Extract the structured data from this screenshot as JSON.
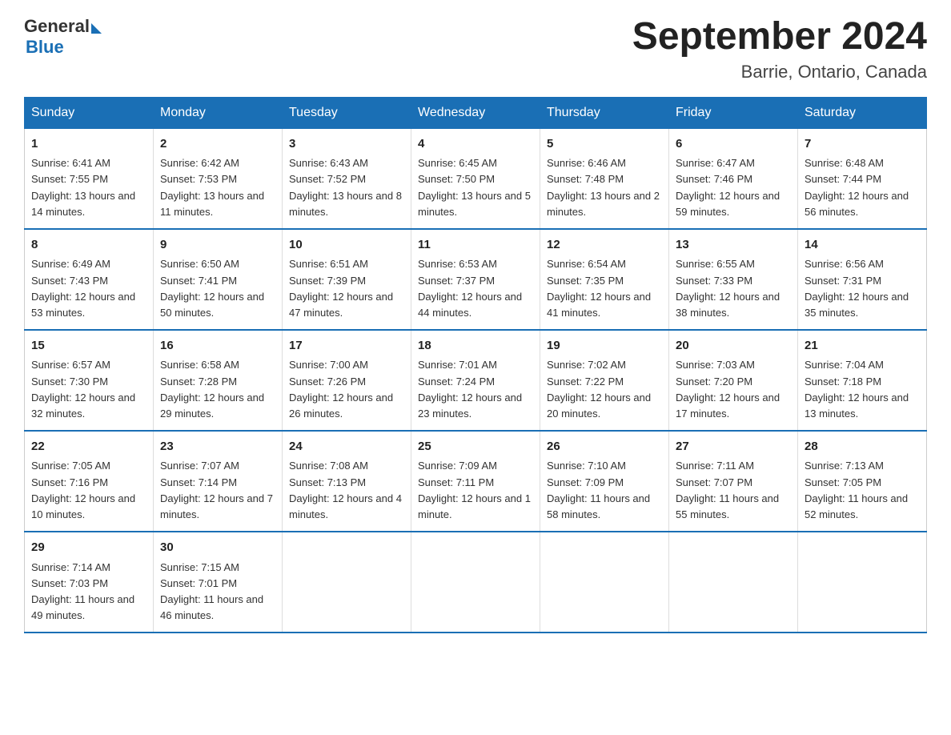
{
  "header": {
    "logo_general": "General",
    "logo_blue": "Blue",
    "month_title": "September 2024",
    "location": "Barrie, Ontario, Canada"
  },
  "days_of_week": [
    "Sunday",
    "Monday",
    "Tuesday",
    "Wednesday",
    "Thursday",
    "Friday",
    "Saturday"
  ],
  "weeks": [
    [
      {
        "day": "1",
        "sunrise": "6:41 AM",
        "sunset": "7:55 PM",
        "daylight": "13 hours and 14 minutes."
      },
      {
        "day": "2",
        "sunrise": "6:42 AM",
        "sunset": "7:53 PM",
        "daylight": "13 hours and 11 minutes."
      },
      {
        "day": "3",
        "sunrise": "6:43 AM",
        "sunset": "7:52 PM",
        "daylight": "13 hours and 8 minutes."
      },
      {
        "day": "4",
        "sunrise": "6:45 AM",
        "sunset": "7:50 PM",
        "daylight": "13 hours and 5 minutes."
      },
      {
        "day": "5",
        "sunrise": "6:46 AM",
        "sunset": "7:48 PM",
        "daylight": "13 hours and 2 minutes."
      },
      {
        "day": "6",
        "sunrise": "6:47 AM",
        "sunset": "7:46 PM",
        "daylight": "12 hours and 59 minutes."
      },
      {
        "day": "7",
        "sunrise": "6:48 AM",
        "sunset": "7:44 PM",
        "daylight": "12 hours and 56 minutes."
      }
    ],
    [
      {
        "day": "8",
        "sunrise": "6:49 AM",
        "sunset": "7:43 PM",
        "daylight": "12 hours and 53 minutes."
      },
      {
        "day": "9",
        "sunrise": "6:50 AM",
        "sunset": "7:41 PM",
        "daylight": "12 hours and 50 minutes."
      },
      {
        "day": "10",
        "sunrise": "6:51 AM",
        "sunset": "7:39 PM",
        "daylight": "12 hours and 47 minutes."
      },
      {
        "day": "11",
        "sunrise": "6:53 AM",
        "sunset": "7:37 PM",
        "daylight": "12 hours and 44 minutes."
      },
      {
        "day": "12",
        "sunrise": "6:54 AM",
        "sunset": "7:35 PM",
        "daylight": "12 hours and 41 minutes."
      },
      {
        "day": "13",
        "sunrise": "6:55 AM",
        "sunset": "7:33 PM",
        "daylight": "12 hours and 38 minutes."
      },
      {
        "day": "14",
        "sunrise": "6:56 AM",
        "sunset": "7:31 PM",
        "daylight": "12 hours and 35 minutes."
      }
    ],
    [
      {
        "day": "15",
        "sunrise": "6:57 AM",
        "sunset": "7:30 PM",
        "daylight": "12 hours and 32 minutes."
      },
      {
        "day": "16",
        "sunrise": "6:58 AM",
        "sunset": "7:28 PM",
        "daylight": "12 hours and 29 minutes."
      },
      {
        "day": "17",
        "sunrise": "7:00 AM",
        "sunset": "7:26 PM",
        "daylight": "12 hours and 26 minutes."
      },
      {
        "day": "18",
        "sunrise": "7:01 AM",
        "sunset": "7:24 PM",
        "daylight": "12 hours and 23 minutes."
      },
      {
        "day": "19",
        "sunrise": "7:02 AM",
        "sunset": "7:22 PM",
        "daylight": "12 hours and 20 minutes."
      },
      {
        "day": "20",
        "sunrise": "7:03 AM",
        "sunset": "7:20 PM",
        "daylight": "12 hours and 17 minutes."
      },
      {
        "day": "21",
        "sunrise": "7:04 AM",
        "sunset": "7:18 PM",
        "daylight": "12 hours and 13 minutes."
      }
    ],
    [
      {
        "day": "22",
        "sunrise": "7:05 AM",
        "sunset": "7:16 PM",
        "daylight": "12 hours and 10 minutes."
      },
      {
        "day": "23",
        "sunrise": "7:07 AM",
        "sunset": "7:14 PM",
        "daylight": "12 hours and 7 minutes."
      },
      {
        "day": "24",
        "sunrise": "7:08 AM",
        "sunset": "7:13 PM",
        "daylight": "12 hours and 4 minutes."
      },
      {
        "day": "25",
        "sunrise": "7:09 AM",
        "sunset": "7:11 PM",
        "daylight": "12 hours and 1 minute."
      },
      {
        "day": "26",
        "sunrise": "7:10 AM",
        "sunset": "7:09 PM",
        "daylight": "11 hours and 58 minutes."
      },
      {
        "day": "27",
        "sunrise": "7:11 AM",
        "sunset": "7:07 PM",
        "daylight": "11 hours and 55 minutes."
      },
      {
        "day": "28",
        "sunrise": "7:13 AM",
        "sunset": "7:05 PM",
        "daylight": "11 hours and 52 minutes."
      }
    ],
    [
      {
        "day": "29",
        "sunrise": "7:14 AM",
        "sunset": "7:03 PM",
        "daylight": "11 hours and 49 minutes."
      },
      {
        "day": "30",
        "sunrise": "7:15 AM",
        "sunset": "7:01 PM",
        "daylight": "11 hours and 46 minutes."
      },
      null,
      null,
      null,
      null,
      null
    ]
  ],
  "labels": {
    "sunrise": "Sunrise:",
    "sunset": "Sunset:",
    "daylight": "Daylight:"
  }
}
